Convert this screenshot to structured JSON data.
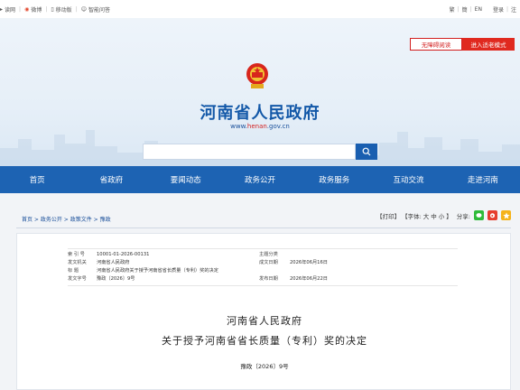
{
  "topbar": {
    "links": [
      {
        "icon": "speaker-icon",
        "label": "读网"
      },
      {
        "icon": "weibo-icon",
        "label": "微博"
      },
      {
        "icon": "mobile-icon",
        "label": "移动版"
      },
      {
        "icon": "robot-icon",
        "label": "智能问答"
      }
    ],
    "lang_simplified": "繁",
    "lang_english": "EN",
    "lang_traditional": "簡",
    "login": "登录",
    "register": "注"
  },
  "accessibility": {
    "barrier_free": "无障碍阅读",
    "elder_mode": "进入适老模式"
  },
  "header": {
    "site_title": "河南省人民政府",
    "url_prefix": "www.",
    "url_highlight": "henan",
    "url_suffix": ".gov.cn",
    "search_placeholder": ""
  },
  "nav": [
    "首页",
    "省政府",
    "要闻动态",
    "政务公开",
    "政务服务",
    "互动交流",
    "走进河南"
  ],
  "breadcrumb": {
    "items": [
      "首页",
      "政务公开",
      "政策文件",
      "豫政"
    ],
    "separator": " > "
  },
  "tools": {
    "print": "【打印】",
    "font_prefix": "【字体:",
    "font_large": "大",
    "font_medium": "中",
    "font_small": "小",
    "font_suffix": "】",
    "share_label": "分享:"
  },
  "document": {
    "meta": [
      {
        "k1": "索 引 号",
        "v1": "10001-01-2026-00131",
        "k2": "主题分类",
        "v2": ""
      },
      {
        "k1": "发文机关",
        "v1": "河南省人民政府",
        "k2": "成文日期",
        "v2": "2026年06月16日"
      },
      {
        "k1": "标    题",
        "v1": "河南省人民政府关于授予河南省省长质量（专利）奖的决定",
        "k2": "",
        "v2": ""
      },
      {
        "k1": "发文字号",
        "v1": "豫政〔2026〕9号",
        "k2": "发布日期",
        "v2": "2026年06月22日"
      }
    ],
    "org": "河南省人民政府",
    "title": "关于授予河南省省长质量（专利）奖的决定",
    "doc_number": "豫政〔2026〕9号"
  },
  "colors": {
    "nav_bg": "#1d63b3",
    "title_blue": "#1358a8",
    "accent_red": "#e0291f"
  }
}
